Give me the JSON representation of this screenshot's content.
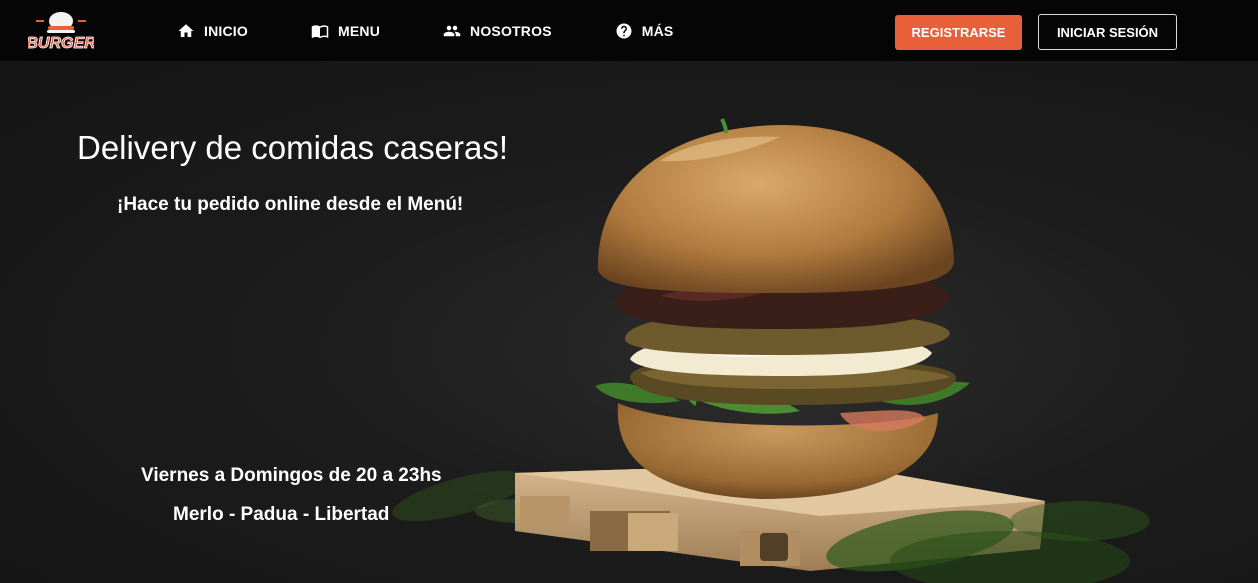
{
  "brand": {
    "logo_text": "BURGER"
  },
  "nav": {
    "items": [
      {
        "label": "INICIO",
        "icon": "home-icon"
      },
      {
        "label": "MENU",
        "icon": "menu-book-icon"
      },
      {
        "label": "NOSOTROS",
        "icon": "people-icon"
      },
      {
        "label": "MÁS",
        "icon": "help-circle-icon"
      }
    ],
    "register_label": "REGISTRARSE",
    "login_label": "INICIAR SESIÓN"
  },
  "hero": {
    "title": "Delivery de comidas caseras!",
    "subtitle": "¡Hace tu pedido online desde el Menú!",
    "hours": "Viernes a Domingos de 20 a 23hs",
    "locations": "Merlo - Padua - Libertad"
  },
  "colors": {
    "navbar": "#050505",
    "accent": "#e8603a",
    "background": "#1b1b1b"
  }
}
